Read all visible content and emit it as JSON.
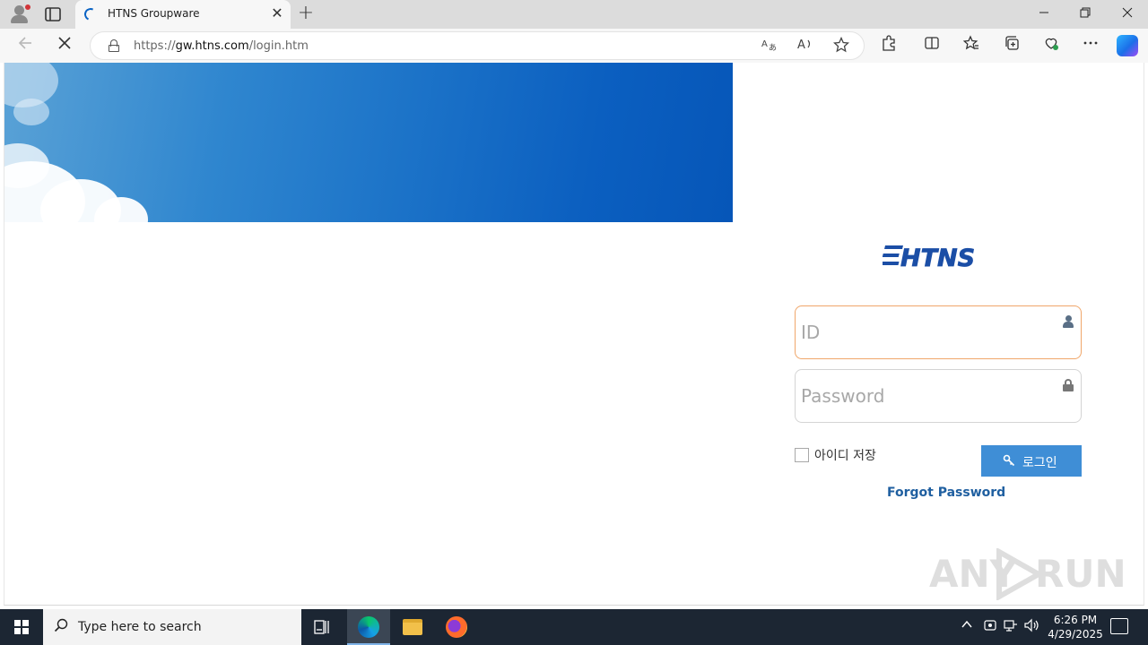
{
  "browser": {
    "tab_title": "HTNS Groupware",
    "url_prefix": "https://",
    "url_host": "gw.htns.com",
    "url_path": "/login.htm",
    "new_tab_symbol": "+",
    "close_symbol": "✕"
  },
  "login": {
    "logo_text": "HTNS",
    "id_placeholder": "ID",
    "password_placeholder": "Password",
    "remember_label": "아이디 저장",
    "login_button": "로그인",
    "forgot_link": "Forgot Password"
  },
  "watermark": {
    "text_left": "ANY",
    "text_right": "RUN"
  },
  "taskbar": {
    "search_placeholder": "Type here to search",
    "time": "6:26 PM",
    "date": "4/29/2025"
  },
  "colors": {
    "accent": "#3f8ed6",
    "focus_border": "#f0a66a",
    "link": "#1f5fa0",
    "logo": "#1b4ea6"
  }
}
